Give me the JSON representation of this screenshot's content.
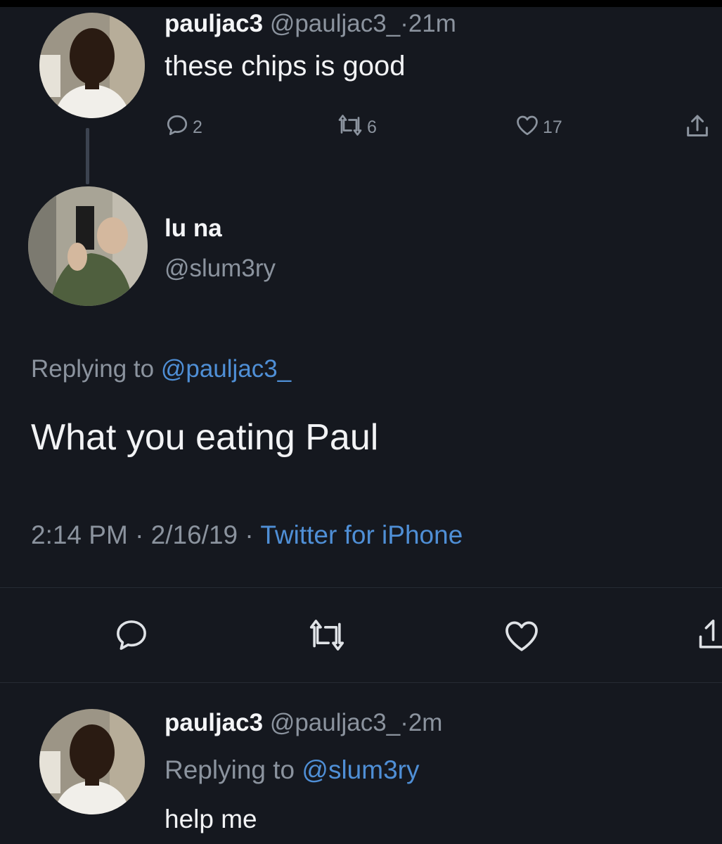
{
  "tweet1": {
    "display_name": "pauljac3",
    "handle": "@pauljac3_",
    "time": "21m",
    "sep": "·",
    "text": "these chips is good",
    "replies": "2",
    "retweets": "6",
    "likes": "17"
  },
  "tweet2": {
    "display_name": "lu na",
    "handle": "@slum3ry",
    "replying_prefix": "Replying to",
    "replying_to": "@pauljac3_",
    "text": "What you eating Paul",
    "timestamp": "2:14 PM · 2/16/19 ·",
    "source": "Twitter for iPhone"
  },
  "tweet3": {
    "display_name": "pauljac3",
    "handle": "@pauljac3_",
    "time": "2m",
    "sep": "·",
    "replying_prefix": "Replying to",
    "replying_to": "@slum3ry",
    "text": "help me"
  },
  "icons": {
    "reply": "reply-icon",
    "retweet": "retweet-icon",
    "like": "heart-icon",
    "share": "share-icon"
  },
  "colors": {
    "background": "#15181f",
    "link": "#4f8fd6",
    "muted": "#8b939e"
  }
}
